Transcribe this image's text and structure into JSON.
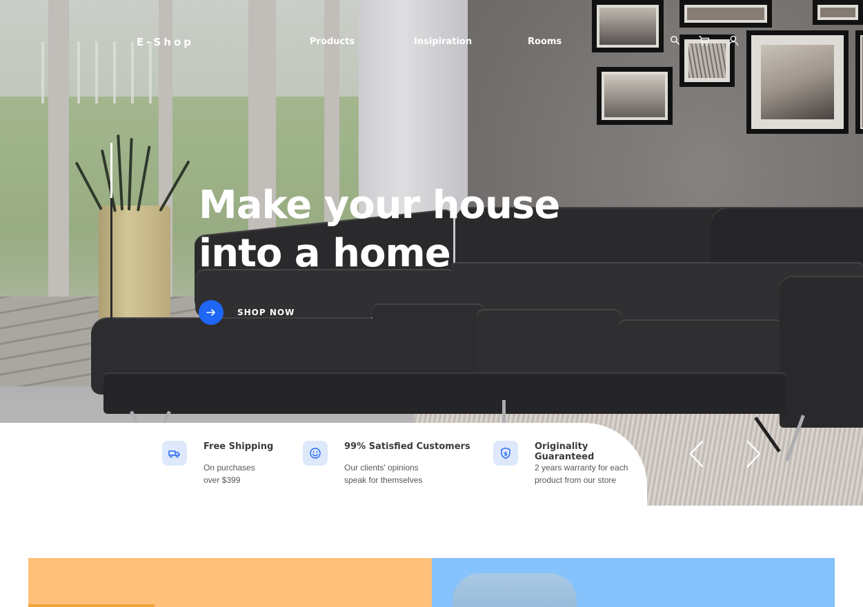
{
  "brand": {
    "logo": "E-Shop",
    "accent_color": "#1f66f5"
  },
  "nav": {
    "links": [
      "Products",
      "Insipiration",
      "Rooms"
    ],
    "icons": [
      "search-icon",
      "cart-icon",
      "user-icon"
    ]
  },
  "hero": {
    "title_line1": "Make your house",
    "title_line2": "into a home",
    "cta_label": "SHOP NOW",
    "cta_icon": "arrow-right-icon"
  },
  "features": [
    {
      "icon": "truck-icon",
      "title": "Free Shipping",
      "desc_line1": "On purchases",
      "desc_line2": "over $399"
    },
    {
      "icon": "smile-icon",
      "title": "99% Satisfied Customers",
      "desc_line1": "Our clients' opinions",
      "desc_line2": "speak for themselves"
    },
    {
      "icon": "shield-dollar-icon",
      "title": "Originality Guaranteed",
      "desc_line1": "2 years warranty for each",
      "desc_line2": "product from our store"
    }
  ],
  "carousel": {
    "prev_icon": "chevron-left-icon",
    "next_icon": "chevron-right-icon"
  },
  "categories": [
    {
      "color": "#ffc07a"
    },
    {
      "color": "#86c2fb"
    }
  ]
}
